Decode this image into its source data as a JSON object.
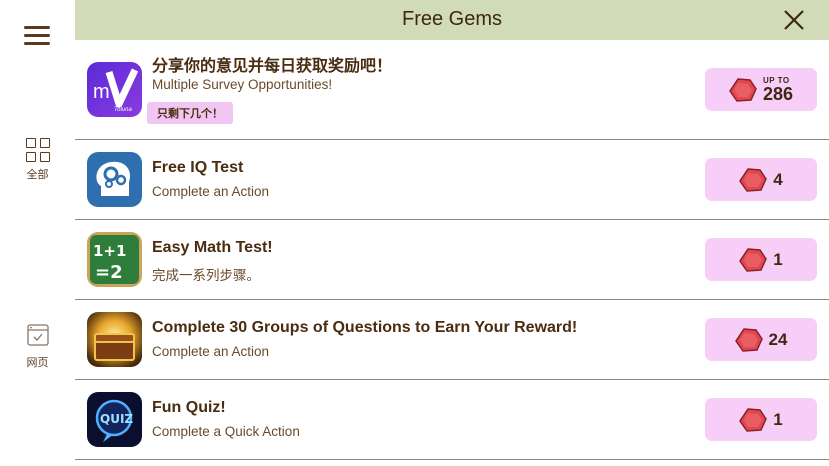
{
  "header": {
    "title": "Free Gems"
  },
  "sidebar": {
    "all_label": "全部",
    "web_label": "网页"
  },
  "offers": [
    {
      "title": "分享你的意见并每日获取奖励吧！",
      "subtitle": "Multiple Survey Opportunities!",
      "badge": "只剩下几个！",
      "reward_prefix": "UP TO",
      "reward": "286",
      "icon": "survey-app-icon"
    },
    {
      "title": "Free IQ Test",
      "subtitle": "Complete an Action",
      "reward": "4",
      "icon": "brain-gears-icon"
    },
    {
      "title": "Easy Math Test!",
      "subtitle": "完成一系列步骤。",
      "reward": "1",
      "icon": "math-chalkboard-icon"
    },
    {
      "title": "Complete 30 Groups of Questions to Earn Your Reward!",
      "subtitle": "Complete an Action",
      "reward": "24",
      "icon": "treasure-chest-icon"
    },
    {
      "title": "Fun Quiz!",
      "subtitle": "Complete a Quick Action",
      "reward": "1",
      "icon": "quiz-icon"
    }
  ],
  "colors": {
    "header_bg": "#d2dbb7",
    "reward_bg": "#f7cef8",
    "badge_bg": "#f2c6f2",
    "gem": "#e0474f",
    "text": "#4a2c10"
  }
}
